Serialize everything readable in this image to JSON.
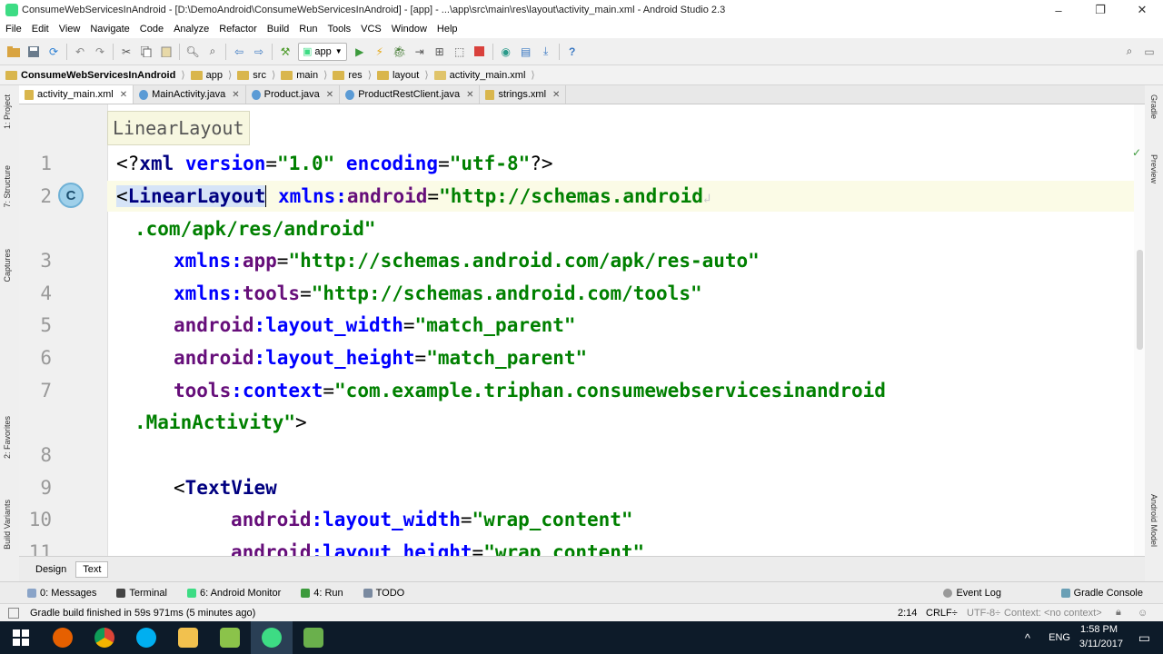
{
  "window": {
    "title": "ConsumeWebServicesInAndroid - [D:\\DemoAndroid\\ConsumeWebServicesInAndroid] - [app] - ...\\app\\src\\main\\res\\layout\\activity_main.xml - Android Studio 2.3",
    "minimize": "–",
    "maximize": "❐",
    "close": "✕"
  },
  "menu": [
    "File",
    "Edit",
    "View",
    "Navigate",
    "Code",
    "Analyze",
    "Refactor",
    "Build",
    "Run",
    "Tools",
    "VCS",
    "Window",
    "Help"
  ],
  "toolbar": {
    "run_config": "app",
    "help": "?"
  },
  "breadcrumb": [
    "ConsumeWebServicesInAndroid",
    "app",
    "src",
    "main",
    "res",
    "layout",
    "activity_main.xml"
  ],
  "left_tool_tabs": [
    "1: Project",
    "7: Structure",
    "Captures",
    "2: Favorites",
    "Build Variants"
  ],
  "right_tool_tabs": [
    "Gradle",
    "Preview",
    "Android Model"
  ],
  "tabs": [
    {
      "label": "activity_main.xml",
      "color": "#d9b64d"
    },
    {
      "label": "MainActivity.java",
      "color": "#5b9bd5"
    },
    {
      "label": "Product.java",
      "color": "#5b9bd5"
    },
    {
      "label": "ProductRestClient.java",
      "color": "#5b9bd5"
    },
    {
      "label": "strings.xml",
      "color": "#d9b64d"
    }
  ],
  "editor": {
    "tooltip": "LinearLayout",
    "gutter_badge": "C",
    "line_numbers": [
      "1",
      "2",
      "3",
      "4",
      "5",
      "6",
      "7",
      "8",
      "9",
      "10",
      "11"
    ],
    "lines": {
      "l1": [
        "<?",
        "xml ",
        "version",
        "=",
        "\"1.0\"",
        " ",
        "encoding",
        "=",
        "\"utf-8\"",
        "?>"
      ],
      "l2": [
        "<",
        "LinearLayout",
        " ",
        "xmlns:",
        "android",
        "=",
        "\"http://schemas.android"
      ],
      "l2b": ".com/apk/res/android\"",
      "l3": [
        "xmlns:",
        "app",
        "=",
        "\"http://schemas.android.com/apk/res-auto\""
      ],
      "l4": [
        "xmlns:",
        "tools",
        "=",
        "\"http://schemas.android.com/tools\""
      ],
      "l5": [
        "android",
        ":layout_width",
        "=",
        "\"match_parent\""
      ],
      "l6": [
        "android",
        ":layout_height",
        "=",
        "\"match_parent\""
      ],
      "l7": [
        "tools",
        ":context",
        "=",
        "\"com.example.triphan.consumewebservicesinandroid"
      ],
      "l7b": [
        ".MainActivity\"",
        ">"
      ],
      "l9": [
        "<",
        "TextView"
      ],
      "l10": [
        "android",
        ":layout_width",
        "=",
        "\"wrap_content\""
      ],
      "l11": [
        "android",
        ":layout_height",
        "=",
        "\"wrap_content\""
      ]
    }
  },
  "mode_tabs": [
    "Design",
    "Text"
  ],
  "tool_windows_left": [
    "0: Messages",
    "Terminal",
    "6: Android Monitor",
    "4: Run",
    "TODO"
  ],
  "tool_windows_right": [
    "Event Log",
    "Gradle Console"
  ],
  "status": {
    "message": "Gradle build finished in 59s 971ms (5 minutes ago)",
    "position": "2:14",
    "line_sep": "CRLF÷",
    "encoding": "UTF-8÷",
    "context": "Context: <no context>"
  },
  "taskbar": {
    "language": "ENG",
    "time": "1:58 PM",
    "date": "3/11/2017",
    "caret": "^"
  }
}
